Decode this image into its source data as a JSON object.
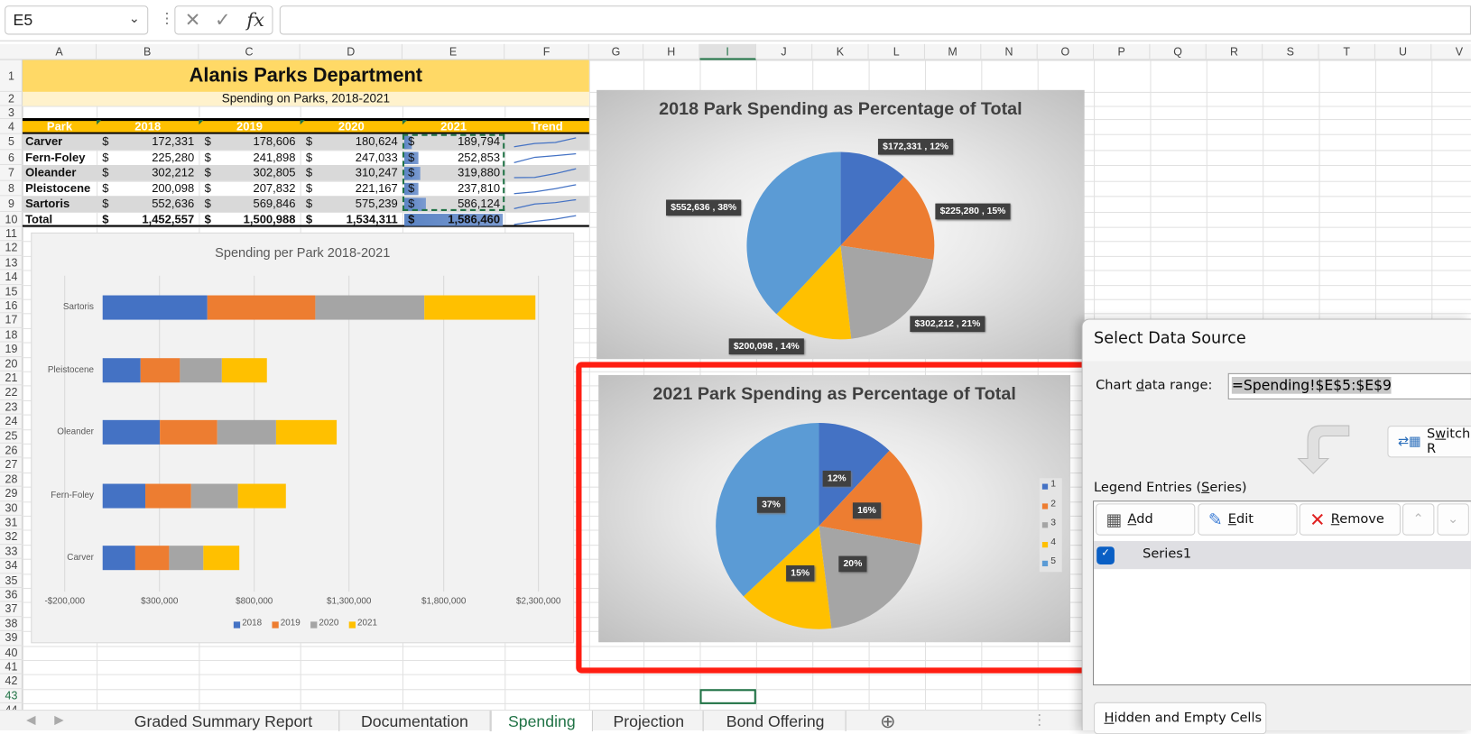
{
  "formula_bar": {
    "name_box": "E5",
    "formula": "",
    "icons": [
      "cancel-icon",
      "enter-icon",
      "function-icon"
    ],
    "fx_label": "fx"
  },
  "columns": [
    "A",
    "B",
    "C",
    "D",
    "E",
    "F",
    "G",
    "H",
    "I",
    "J",
    "K",
    "L",
    "M",
    "N",
    "O",
    "P",
    "Q",
    "R",
    "S",
    "T",
    "U",
    "V"
  ],
  "rows": [
    "1",
    "2",
    "3",
    "4",
    "5",
    "6",
    "7",
    "8",
    "9",
    "10",
    "11",
    "12",
    "13",
    "14",
    "15",
    "16",
    "17",
    "18",
    "19",
    "20",
    "21",
    "22",
    "23",
    "24",
    "25",
    "26",
    "27",
    "28",
    "29",
    "30",
    "31",
    "32",
    "33",
    "34",
    "35",
    "36",
    "37",
    "38",
    "39",
    "40",
    "41",
    "42",
    "43",
    "44"
  ],
  "selected_cell": "I43",
  "sheet": {
    "title": "Alanis Parks Department",
    "subtitle": "Spending on Parks, 2018-2021",
    "currency": "$",
    "headers": [
      "Park",
      "2018",
      "2019",
      "2020",
      "2021",
      "Trend"
    ],
    "data": [
      {
        "park": "Carver",
        "values": [
          "172,331",
          "178,606",
          "180,624",
          "189,794"
        ]
      },
      {
        "park": "Fern-Foley",
        "values": [
          "225,280",
          "241,898",
          "247,033",
          "252,853"
        ]
      },
      {
        "park": "Oleander",
        "values": [
          "302,212",
          "302,805",
          "310,247",
          "319,880"
        ]
      },
      {
        "park": "Pleistocene",
        "values": [
          "200,098",
          "207,832",
          "221,167",
          "237,810"
        ]
      },
      {
        "park": "Sartoris",
        "values": [
          "552,636",
          "569,846",
          "575,239",
          "586,124"
        ]
      },
      {
        "park": "Total",
        "values": [
          "1,452,557",
          "1,500,988",
          "1,534,311",
          "1,586,460"
        ]
      }
    ],
    "colors": {
      "title_bg": "#ffd966",
      "subtitle_bg": "#fff2cc",
      "header_bg": "#ffc000",
      "band": "#d9d9d9",
      "databar": "#6a8fcb"
    }
  },
  "chart_data": [
    {
      "type": "bar",
      "orientation": "horizontal",
      "stacked": true,
      "title": "Spending per Park 2018-2021",
      "categories": [
        "Carver",
        "Fern-Foley",
        "Oleander",
        "Pleistocene",
        "Sartoris"
      ],
      "series": [
        {
          "name": "2018",
          "color": "#4472c4",
          "values": [
            172331,
            225280,
            302212,
            200098,
            552636
          ]
        },
        {
          "name": "2019",
          "color": "#ed7d31",
          "values": [
            178606,
            241898,
            302805,
            207832,
            569846
          ]
        },
        {
          "name": "2020",
          "color": "#a5a5a5",
          "values": [
            180624,
            247033,
            310247,
            221167,
            575239
          ]
        },
        {
          "name": "2021",
          "color": "#ffc000",
          "values": [
            189794,
            252853,
            319880,
            237810,
            586124
          ]
        }
      ],
      "xlim": [
        -200000,
        2300000
      ],
      "x_ticks": [
        "-$200,000",
        "$300,000",
        "$800,000",
        "$1,300,000",
        "$1,800,000",
        "$2,300,000"
      ],
      "grid": true,
      "legend": "bottom"
    },
    {
      "type": "pie",
      "title": "2018 Park Spending as Percentage of Total",
      "values": [
        172331,
        225280,
        302212,
        200098,
        552636
      ],
      "percents": [
        12,
        15,
        21,
        14,
        38
      ],
      "labels": [
        "$172,331 , 12%",
        "$225,280 , 15%",
        "$302,212 , 21%",
        "$200,098 , 14%",
        "$552,636 , 38%"
      ],
      "colors": [
        "#4472c4",
        "#ed7d31",
        "#a5a5a5",
        "#ffc000",
        "#5b9bd5"
      ]
    },
    {
      "type": "pie",
      "title": "2021 Park Spending as Percentage of Total",
      "values": [
        189794,
        252853,
        319880,
        237810,
        586124
      ],
      "percents": [
        12,
        16,
        20,
        15,
        37
      ],
      "labels": [
        "12%",
        "16%",
        "20%",
        "15%",
        "37%"
      ],
      "legend": [
        "1",
        "2",
        "3",
        "4",
        "5"
      ],
      "legend_position": "right",
      "colors": [
        "#4472c4",
        "#ed7d31",
        "#a5a5a5",
        "#ffc000",
        "#5b9bd5"
      ]
    }
  ],
  "dialog": {
    "title": "Select Data Source",
    "range_label_pre": "Chart ",
    "range_label_u": "d",
    "range_label_post": "ata range:",
    "range_value": "=Spending!$E$5:$E$9",
    "switch_pre": "S",
    "switch_u": "w",
    "switch_post": "itch R",
    "legend_pre": "Legend Entries (",
    "legend_u": "S",
    "legend_post": "eries)",
    "add_u": "A",
    "add_post": "dd",
    "edit_u": "E",
    "edit_post": "dit",
    "remove_u": "R",
    "remove_post": "emove",
    "series": [
      {
        "name": "Series1",
        "checked": true
      }
    ],
    "hidden_u": "H",
    "hidden_post": "idden and Empty Cells"
  },
  "tabs": [
    {
      "label": "Graded Summary Report",
      "active": false
    },
    {
      "label": "Documentation",
      "active": false
    },
    {
      "label": "Spending",
      "active": true
    },
    {
      "label": "Projection",
      "active": false
    },
    {
      "label": "Bond Offering",
      "active": false
    }
  ],
  "highlight_color": "#ff1e12"
}
